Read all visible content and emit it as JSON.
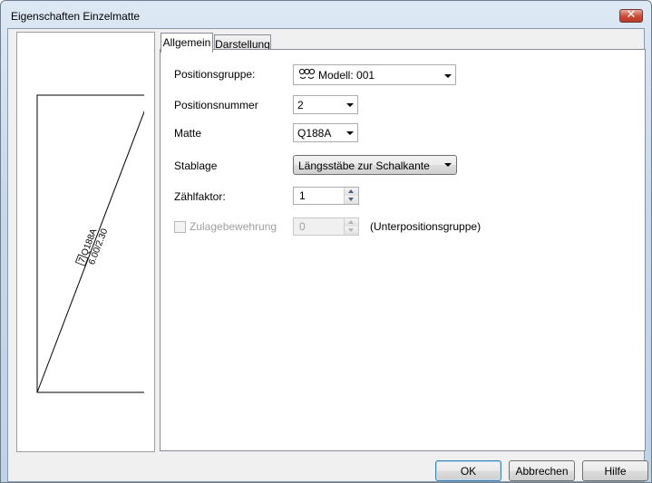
{
  "window": {
    "title": "Eigenschaften Einzelmatte",
    "close_glyph": "✕"
  },
  "preview": {
    "mat_label": "7 Q188A",
    "dim_label": "6.00/2.30"
  },
  "tabs": [
    {
      "label": "Allgemein",
      "active": true
    },
    {
      "label": "Darstellung",
      "active": false
    }
  ],
  "form": {
    "positionsgruppe": {
      "label": "Positionsgruppe:",
      "value": "Modell: 001",
      "icon": "group-icon"
    },
    "positionsnummer": {
      "label": "Positionsnummer",
      "value": "2"
    },
    "matte": {
      "label": "Matte",
      "value": "Q188A"
    },
    "stablage": {
      "label": "Stablage",
      "value": "Längsstäbe zur Schalkante"
    },
    "zaehlfaktor": {
      "label": "Zählfaktor:",
      "value": "1"
    },
    "zulage": {
      "label": "Zulagebewehrung",
      "value": "0",
      "checked": false,
      "enabled": false,
      "suffix": "(Unterpositionsgruppe)"
    }
  },
  "buttons": {
    "ok": "OK",
    "cancel": "Abbrechen",
    "help": "Hilfe"
  },
  "colors": {
    "title_bar": "#c9d9ec",
    "close_button": "#c94a36",
    "default_button_border": "#3c7fb1"
  }
}
